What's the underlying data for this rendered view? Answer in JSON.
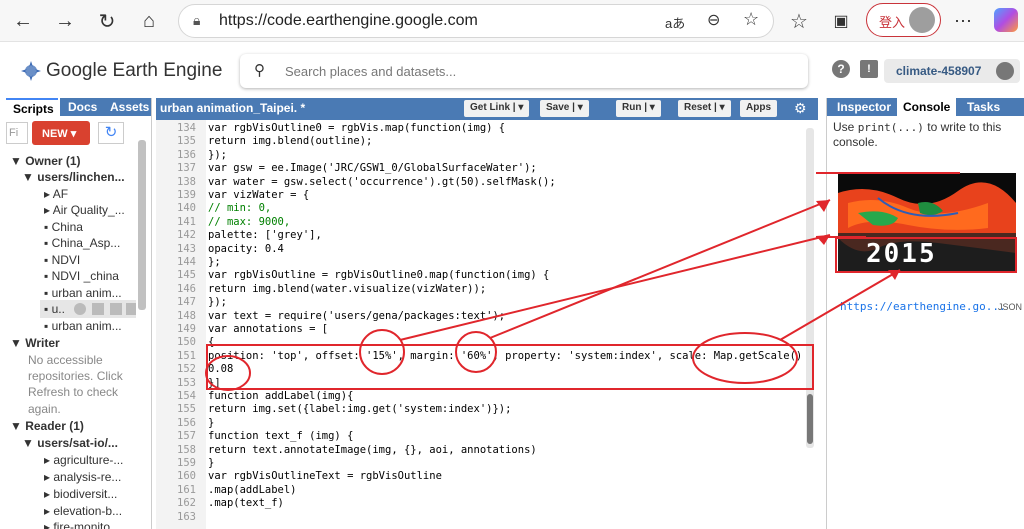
{
  "browser": {
    "url": "https://code.earthengine.google.com",
    "login_label": "登入",
    "read_aloud_glyph": "aあ"
  },
  "header": {
    "logo_text": "Google Earth Engine",
    "search_placeholder": "Search places and datasets...",
    "project": "climate-458907"
  },
  "left": {
    "tabs": [
      "Scripts",
      "Docs",
      "Assets"
    ],
    "filter_placeholder": "Fi",
    "new_label": "NEW",
    "tree": [
      {
        "text": "▼ Owner (1)",
        "bold": true
      },
      {
        "text": "▼ users/linchen...",
        "bold": true
      },
      {
        "text": "▸ AF"
      },
      {
        "text": "▸ Air Quality_..."
      },
      {
        "text": "China"
      },
      {
        "text": "China_Asp..."
      },
      {
        "text": "NDVI"
      },
      {
        "text": "NDVI _china"
      },
      {
        "text": "urban anim..."
      },
      {
        "text": "u.."
      },
      {
        "text": "urban anim..."
      },
      {
        "text": "▼ Writer",
        "bold": true
      }
    ],
    "writer_note": [
      "No accessible",
      "repositories. Click",
      "Refresh to check",
      "again."
    ],
    "reader": {
      "label": "▼ Reader (1)",
      "user": "▼ users/sat-io/..."
    },
    "reader_items": [
      "▸ agriculture-...",
      "▸ analysis-re...",
      "▸ biodiversit...",
      "▸ elevation-b...",
      "▸ fire-monito..."
    ]
  },
  "editor": {
    "title": "urban animation_Taipei. *",
    "buttons": {
      "get_link": "Get Link",
      "save": "Save",
      "run": "Run",
      "reset": "Reset",
      "apps": "Apps"
    },
    "lines": [
      {
        "n": "134",
        "code": "var rgbVisOutline0 = rgbVis.map(function(img) {"
      },
      {
        "n": "135",
        "code": "return img.blend(outline);"
      },
      {
        "n": "136",
        "code": "});"
      },
      {
        "n": "137",
        "code": "var gsw = ee.Image('JRC/GSW1_0/GlobalSurfaceWater');"
      },
      {
        "n": "138",
        "code": "var water = gsw.select('occurrence').gt(50).selfMask();"
      },
      {
        "n": "139",
        "code": "var vizWater = {"
      },
      {
        "n": "140",
        "code": "// min: 0,"
      },
      {
        "n": "141",
        "code": "// max: 9000,"
      },
      {
        "n": "142",
        "code": "palette: ['grey'],"
      },
      {
        "n": "143",
        "code": "opacity: 0.4"
      },
      {
        "n": "144",
        "code": "};"
      },
      {
        "n": "145",
        "code": "var rgbVisOutline = rgbVisOutline0.map(function(img) {"
      },
      {
        "n": "146",
        "code": "return img.blend(water.visualize(vizWater));"
      },
      {
        "n": "147",
        "code": "});"
      },
      {
        "n": "148",
        "code": "var text = require('users/gena/packages:text');"
      },
      {
        "n": "149",
        "code": "var annotations = ["
      },
      {
        "n": "150",
        "code": "{"
      },
      {
        "n": "151",
        "code": "position: 'top', offset: '15%', margin: '60%', property: 'system:index', scale: Map.getScale() *"
      },
      {
        "n": "152",
        "code": "0.08"
      },
      {
        "n": "153",
        "code": "}]"
      },
      {
        "n": "154",
        "code": "function addLabel(img){"
      },
      {
        "n": "155",
        "code": "return img.set({label:img.get('system:index')});"
      },
      {
        "n": "156",
        "code": "}"
      },
      {
        "n": "157",
        "code": "function text_f (img) {"
      },
      {
        "n": "158",
        "code": "return text.annotateImage(img, {}, aoi, annotations)"
      },
      {
        "n": "159",
        "code": "}"
      },
      {
        "n": "160",
        "code": "var rgbVisOutlineText = rgbVisOutline"
      },
      {
        "n": "161",
        "code": ".map(addLabel)"
      },
      {
        "n": "162",
        "code": ".map(text_f)"
      },
      {
        "n": "163",
        "code": ""
      }
    ]
  },
  "right": {
    "tabs": [
      "Inspector",
      "Console",
      "Tasks"
    ],
    "console_intro_1": "Use ",
    "console_intro_code": "print(...)",
    "console_intro_2": " to write to this console.",
    "thumb_year": "2015",
    "link": "https://earthengine.go...",
    "json_label": "JSON"
  },
  "colors": {
    "accent": "#4a7ab4",
    "annotation": "#e0262c",
    "new_button": "#d9412f"
  }
}
